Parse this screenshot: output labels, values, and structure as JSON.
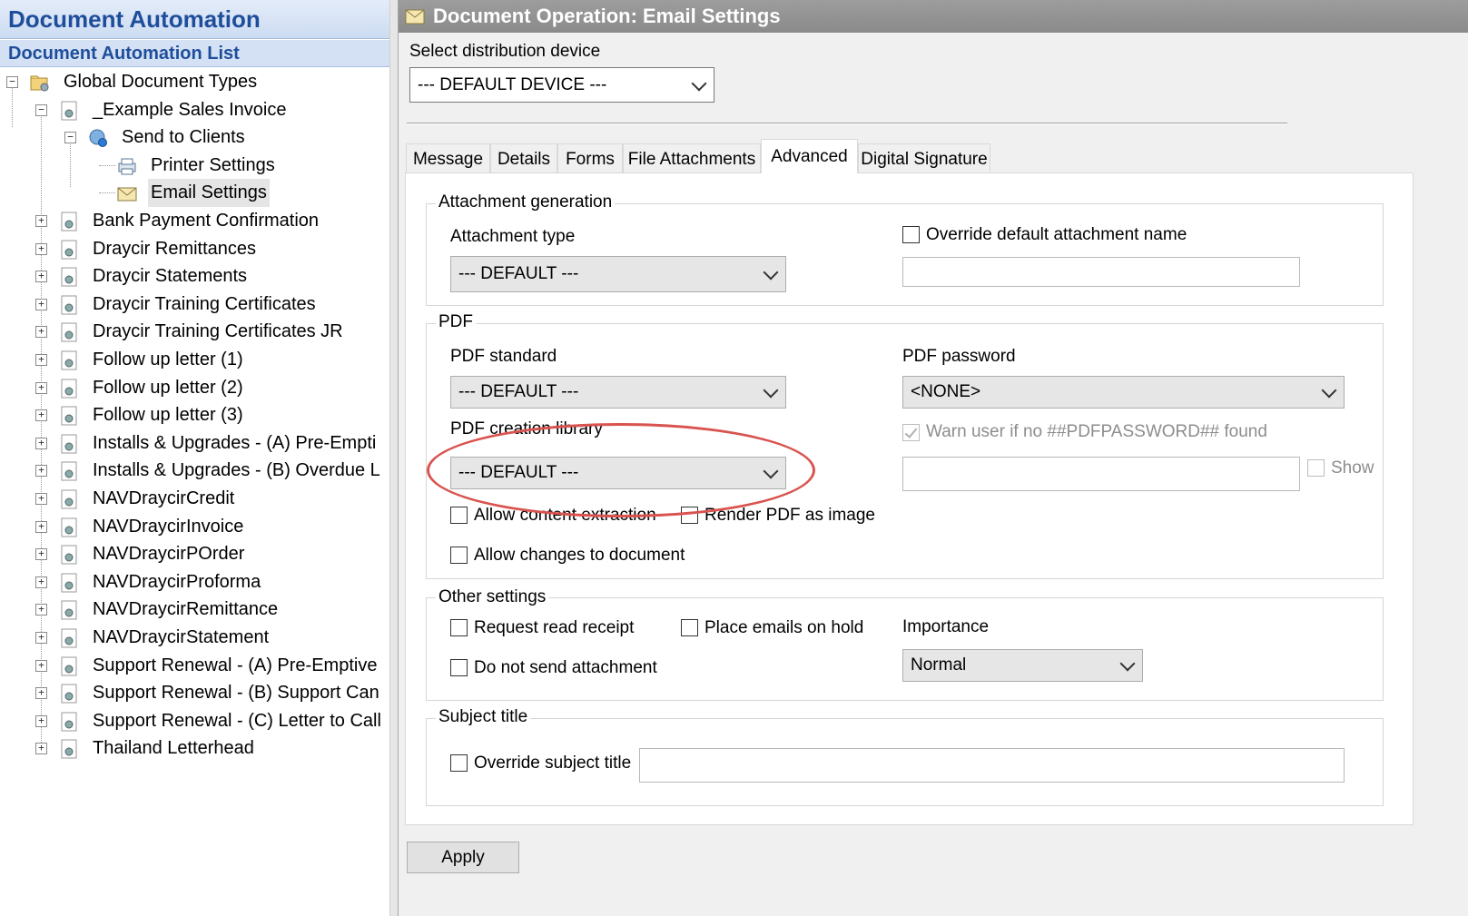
{
  "left_pane": {
    "title": "Document Automation",
    "subtitle": "Document Automation List",
    "tree": [
      {
        "label": "Global Document Types",
        "level": 0,
        "expander": "minus",
        "icon": "folder-gear-icon"
      },
      {
        "label": "_Example Sales Invoice",
        "level": 1,
        "expander": "minus",
        "icon": "document-gear-icon"
      },
      {
        "label": "Send to Clients",
        "level": 2,
        "expander": "minus",
        "icon": "globe-gear-icon"
      },
      {
        "label": "Printer Settings",
        "level": 3,
        "expander": "",
        "icon": "printer-icon"
      },
      {
        "label": "Email Settings",
        "level": 3,
        "expander": "",
        "icon": "envelope-icon",
        "selected": true
      },
      {
        "label": "Bank Payment Confirmation",
        "level": 1,
        "expander": "plus",
        "icon": "document-gear-icon"
      },
      {
        "label": "Draycir Remittances",
        "level": 1,
        "expander": "plus",
        "icon": "document-gear-icon"
      },
      {
        "label": "Draycir Statements",
        "level": 1,
        "expander": "plus",
        "icon": "document-gear-icon"
      },
      {
        "label": "Draycir Training Certificates",
        "level": 1,
        "expander": "plus",
        "icon": "document-gear-icon"
      },
      {
        "label": "Draycir Training Certificates JR",
        "level": 1,
        "expander": "plus",
        "icon": "document-gear-icon"
      },
      {
        "label": "Follow up letter (1)",
        "level": 1,
        "expander": "plus",
        "icon": "document-gear-icon"
      },
      {
        "label": "Follow up letter (2)",
        "level": 1,
        "expander": "plus",
        "icon": "document-gear-icon"
      },
      {
        "label": "Follow up letter (3)",
        "level": 1,
        "expander": "plus",
        "icon": "document-gear-icon"
      },
      {
        "label": "Installs & Upgrades - (A) Pre-Empti",
        "level": 1,
        "expander": "plus",
        "icon": "document-gear-icon"
      },
      {
        "label": "Installs & Upgrades - (B) Overdue L",
        "level": 1,
        "expander": "plus",
        "icon": "document-gear-icon"
      },
      {
        "label": "NAVDraycirCredit",
        "level": 1,
        "expander": "plus",
        "icon": "document-gear-icon"
      },
      {
        "label": "NAVDraycirInvoice",
        "level": 1,
        "expander": "plus",
        "icon": "document-gear-icon"
      },
      {
        "label": "NAVDraycirPOrder",
        "level": 1,
        "expander": "plus",
        "icon": "document-gear-icon"
      },
      {
        "label": "NAVDraycirProforma",
        "level": 1,
        "expander": "plus",
        "icon": "document-gear-icon"
      },
      {
        "label": "NAVDraycirRemittance",
        "level": 1,
        "expander": "plus",
        "icon": "document-gear-icon"
      },
      {
        "label": "NAVDraycirStatement",
        "level": 1,
        "expander": "plus",
        "icon": "document-gear-icon"
      },
      {
        "label": "Support Renewal - (A) Pre-Emptive",
        "level": 1,
        "expander": "plus",
        "icon": "document-gear-icon"
      },
      {
        "label": "Support Renewal - (B) Support Can",
        "level": 1,
        "expander": "plus",
        "icon": "document-gear-icon"
      },
      {
        "label": "Support Renewal - (C) Letter to Call",
        "level": 1,
        "expander": "plus",
        "icon": "document-gear-icon"
      },
      {
        "label": "Thailand Letterhead",
        "level": 1,
        "expander": "plus",
        "icon": "document-gear-icon"
      }
    ]
  },
  "right_pane": {
    "title": "Document Operation: Email Settings",
    "distribution_label": "Select distribution device",
    "distribution_value": "--- DEFAULT DEVICE ---",
    "tabs": [
      "Message",
      "Details",
      "Forms",
      "File Attachments",
      "Advanced",
      "Digital Signature"
    ],
    "active_tab": "Advanced",
    "attachment_generation": {
      "group_title": "Attachment generation",
      "attachment_type_label": "Attachment type",
      "attachment_type_value": "--- DEFAULT ---",
      "override_name_label": "Override default attachment name",
      "override_name_checked": false
    },
    "pdf": {
      "group_title": "PDF",
      "standard_label": "PDF standard",
      "standard_value": "--- DEFAULT ---",
      "password_label": "PDF password",
      "password_value": "<NONE>",
      "creation_library_label": "PDF creation library",
      "creation_library_value": "--- DEFAULT ---",
      "warn_label": "Warn user if no ##PDFPASSWORD## found",
      "warn_checked": true,
      "show_label": "Show",
      "allow_extraction_label": "Allow content extraction",
      "render_image_label": "Render PDF as image",
      "allow_changes_label": "Allow changes to document"
    },
    "other_settings": {
      "group_title": "Other settings",
      "read_receipt_label": "Request read receipt",
      "on_hold_label": "Place emails on hold",
      "no_attachment_label": "Do not send attachment",
      "importance_label": "Importance",
      "importance_value": "Normal"
    },
    "subject_title": {
      "group_title": "Subject title",
      "override_label": "Override subject title"
    },
    "apply_label": "Apply",
    "annotation_color": "#d9534f"
  }
}
